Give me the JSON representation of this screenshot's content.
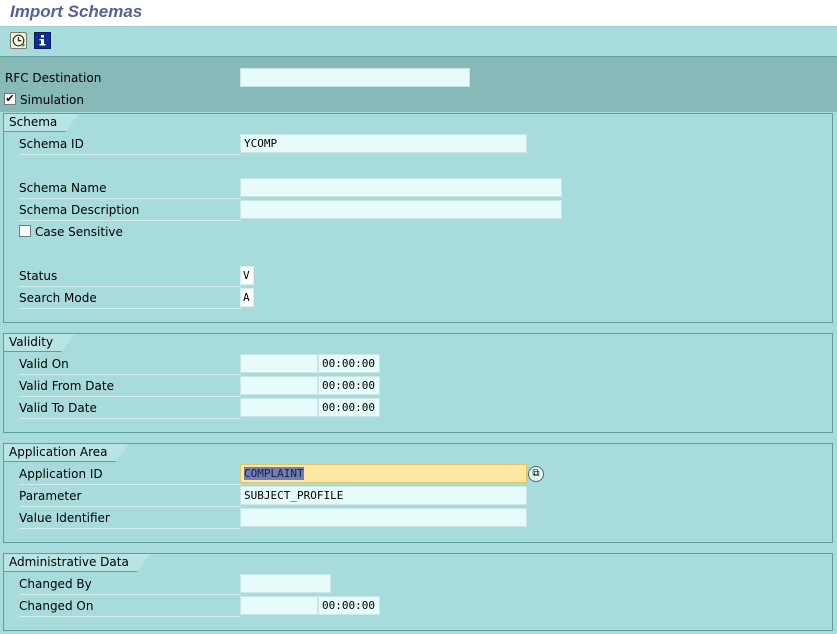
{
  "window": {
    "title": "Import Schemas"
  },
  "toolbar": {
    "execute_icon": "execute-icon",
    "info_icon": "info-icon"
  },
  "header": {
    "rfc_destination_label": "RFC Destination",
    "rfc_destination_value": "",
    "simulation_label": "Simulation",
    "simulation_checked": true
  },
  "schema": {
    "group_title": "Schema",
    "schema_id_label": "Schema ID",
    "schema_id_value": "YCOMP",
    "schema_name_label": "Schema Name",
    "schema_name_value": "",
    "schema_description_label": "Schema Description",
    "schema_description_value": "",
    "case_sensitive_label": "Case Sensitive",
    "case_sensitive_checked": false,
    "status_label": "Status",
    "status_value": "V",
    "search_mode_label": "Search Mode",
    "search_mode_value": "A"
  },
  "validity": {
    "group_title": "Validity",
    "valid_on_label": "Valid On",
    "valid_on_date": "",
    "valid_on_time": "00:00:00",
    "valid_from_label": "Valid From Date",
    "valid_from_date": "",
    "valid_from_time": "00:00:00",
    "valid_to_label": "Valid To Date",
    "valid_to_date": "",
    "valid_to_time": "00:00:00"
  },
  "application_area": {
    "group_title": "Application Area",
    "application_id_label": "Application ID",
    "application_id_value": "COMPLAINT",
    "parameter_label": "Parameter",
    "parameter_value": "SUBJECT_PROFILE",
    "value_identifier_label": "Value Identifier",
    "value_identifier_value": ""
  },
  "administrative": {
    "group_title": "Administrative Data",
    "changed_by_label": "Changed By",
    "changed_by_value": "",
    "changed_on_label": "Changed On",
    "changed_on_date": "",
    "changed_on_time": "00:00:00"
  },
  "colors": {
    "background": "#a8dcdc",
    "header_band": "#88b9b9",
    "title_text": "#5a5f99",
    "focus_field": "#fce7a4",
    "input_field": "#e8fbfb"
  }
}
